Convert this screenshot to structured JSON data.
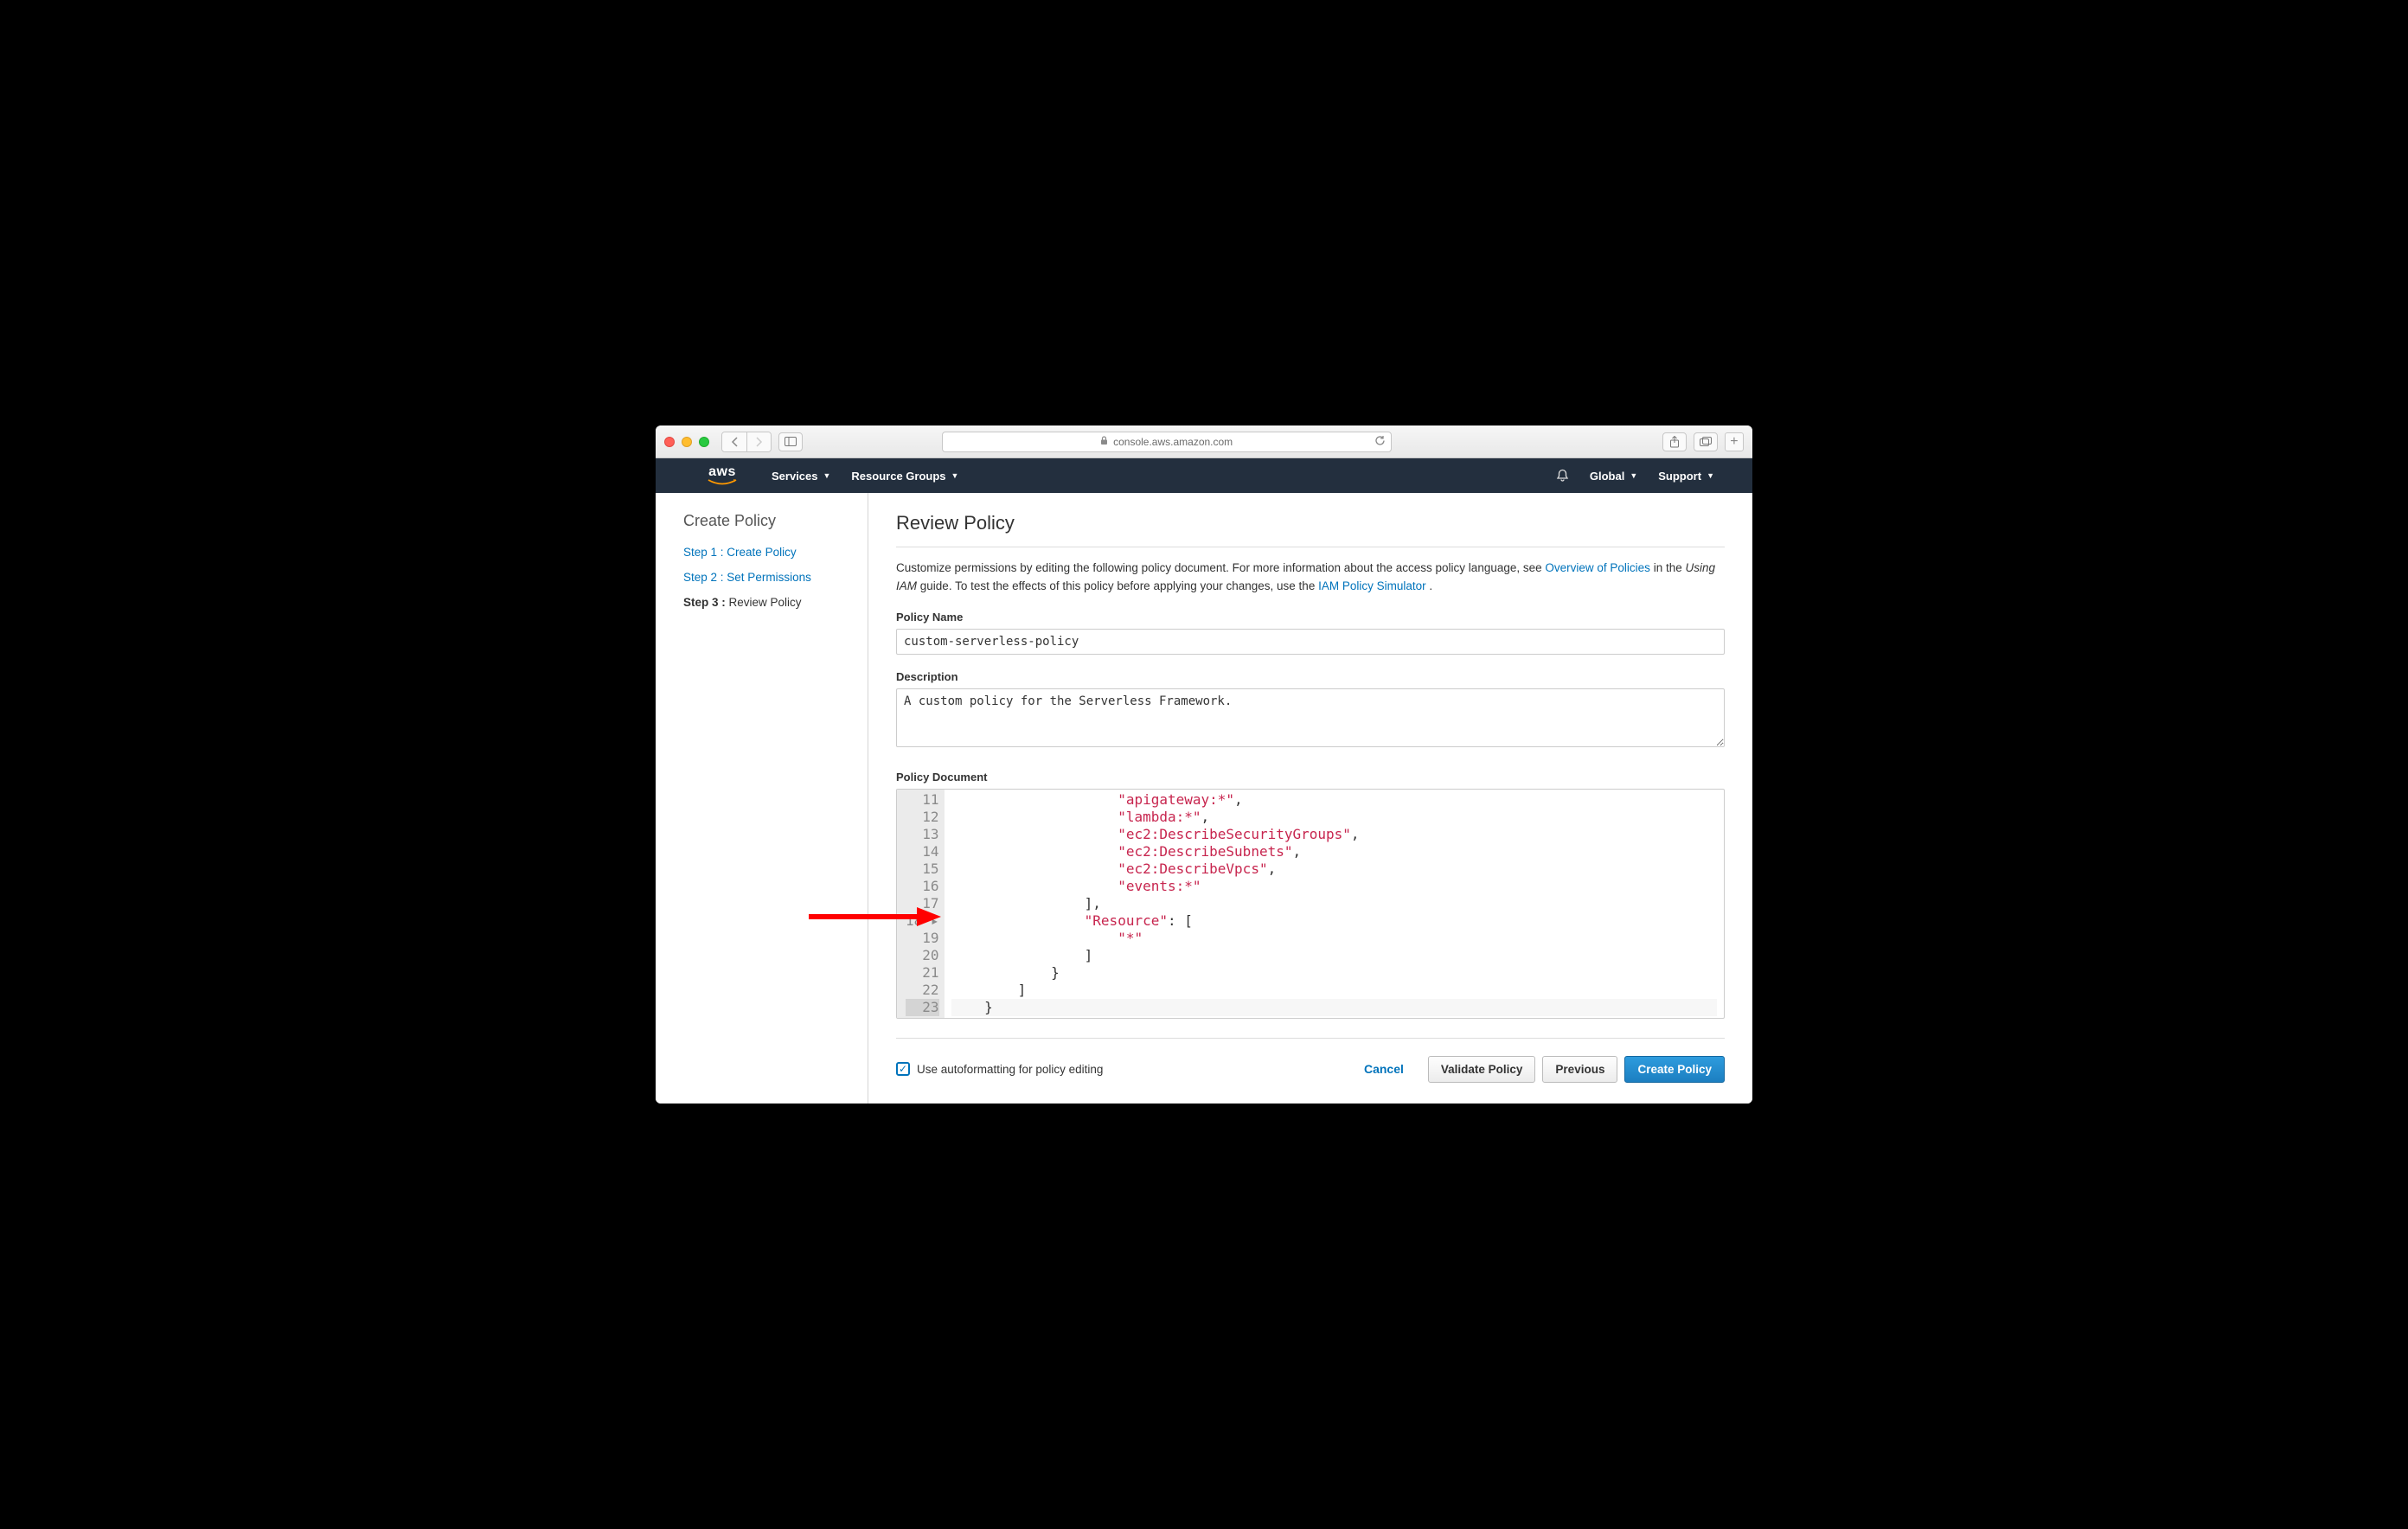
{
  "browser": {
    "url": "console.aws.amazon.com"
  },
  "header": {
    "services": "Services",
    "resource_groups": "Resource Groups",
    "region": "Global",
    "support": "Support"
  },
  "sidebar": {
    "title": "Create Policy",
    "steps": [
      {
        "prefix": "Step 1 :",
        "label": "Create Policy",
        "current": false
      },
      {
        "prefix": "Step 2 :",
        "label": "Set Permissions",
        "current": false
      },
      {
        "prefix": "Step 3 :",
        "label": "Review Policy",
        "current": true
      }
    ]
  },
  "main": {
    "title": "Review Policy",
    "intro_pre": "Customize permissions by editing the following policy document. For more information about the access policy language, see ",
    "intro_link1": "Overview of Policies",
    "intro_mid": " in the ",
    "intro_em": "Using IAM",
    "intro_post1": " guide. To test the effects of this policy before applying your changes, use the ",
    "intro_link2": "IAM Policy Simulator",
    "intro_end": " .",
    "policy_name_label": "Policy Name",
    "policy_name_value": "custom-serverless-policy",
    "description_label": "Description",
    "description_value": "A custom policy for the Serverless Framework.",
    "policy_document_label": "Policy Document",
    "code_lines": [
      {
        "n": "11",
        "indent": "                    ",
        "content": [
          {
            "t": "str",
            "v": "\"apigateway:*\""
          },
          {
            "t": "pun",
            "v": ","
          }
        ]
      },
      {
        "n": "12",
        "indent": "                    ",
        "content": [
          {
            "t": "str",
            "v": "\"lambda:*\""
          },
          {
            "t": "pun",
            "v": ","
          }
        ]
      },
      {
        "n": "13",
        "indent": "                    ",
        "content": [
          {
            "t": "str",
            "v": "\"ec2:DescribeSecurityGroups\""
          },
          {
            "t": "pun",
            "v": ","
          }
        ]
      },
      {
        "n": "14",
        "indent": "                    ",
        "content": [
          {
            "t": "str",
            "v": "\"ec2:DescribeSubnets\""
          },
          {
            "t": "pun",
            "v": ","
          }
        ]
      },
      {
        "n": "15",
        "indent": "                    ",
        "content": [
          {
            "t": "str",
            "v": "\"ec2:DescribeVpcs\""
          },
          {
            "t": "pun",
            "v": ","
          }
        ]
      },
      {
        "n": "16",
        "indent": "                    ",
        "content": [
          {
            "t": "str",
            "v": "\"events:*\""
          }
        ]
      },
      {
        "n": "17",
        "indent": "                ",
        "content": [
          {
            "t": "pun",
            "v": "],"
          }
        ]
      },
      {
        "n": "18",
        "fold": true,
        "indent": "                ",
        "content": [
          {
            "t": "str",
            "v": "\"Resource\""
          },
          {
            "t": "pun",
            "v": ": ["
          }
        ]
      },
      {
        "n": "19",
        "indent": "                    ",
        "content": [
          {
            "t": "str",
            "v": "\"*\""
          }
        ]
      },
      {
        "n": "20",
        "indent": "                ",
        "content": [
          {
            "t": "pun",
            "v": "]"
          }
        ]
      },
      {
        "n": "21",
        "indent": "            ",
        "content": [
          {
            "t": "pun",
            "v": "}"
          }
        ]
      },
      {
        "n": "22",
        "indent": "        ",
        "content": [
          {
            "t": "pun",
            "v": "]"
          }
        ]
      },
      {
        "n": "23",
        "active": true,
        "indent": "    ",
        "content": [
          {
            "t": "pun",
            "v": "}"
          }
        ]
      }
    ],
    "autoformat_label": "Use autoformatting for policy editing",
    "cancel": "Cancel",
    "validate": "Validate Policy",
    "previous": "Previous",
    "create": "Create Policy"
  }
}
